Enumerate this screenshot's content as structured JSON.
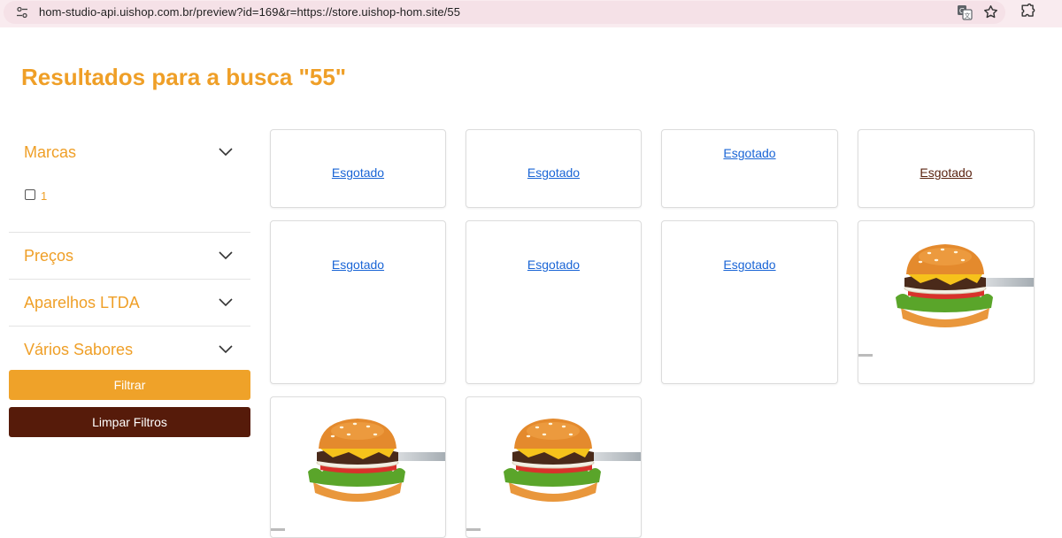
{
  "browser": {
    "url": "hom-studio-api.uishop.com.br/preview?id=169&r=https://store.uishop-hom.site/55"
  },
  "page": {
    "title": "Resultados para a busca \"55\""
  },
  "filters": {
    "sections": [
      {
        "label": "Marcas",
        "options": [
          {
            "label": "1",
            "checked": false
          }
        ]
      },
      {
        "label": "Preços"
      },
      {
        "label": "Aparelhos LTDA"
      },
      {
        "label": "Vários Sabores"
      }
    ],
    "filter_button": "Filtrar",
    "clear_button": "Limpar Filtros"
  },
  "products": [
    {
      "status": "Esgotado"
    },
    {
      "status": "Esgotado"
    },
    {
      "status": "Esgotado"
    },
    {
      "status": "Esgotado"
    },
    {
      "status": "Esgotado"
    },
    {
      "status": "Esgotado"
    },
    {
      "status": "Esgotado"
    },
    {
      "image": "burger"
    },
    {
      "image": "burger"
    },
    {
      "image": "burger"
    }
  ],
  "colors": {
    "accent": "#ef9f27",
    "button_primary": "#efa229",
    "button_secondary": "#561b0a",
    "link": "#1a65d6"
  }
}
